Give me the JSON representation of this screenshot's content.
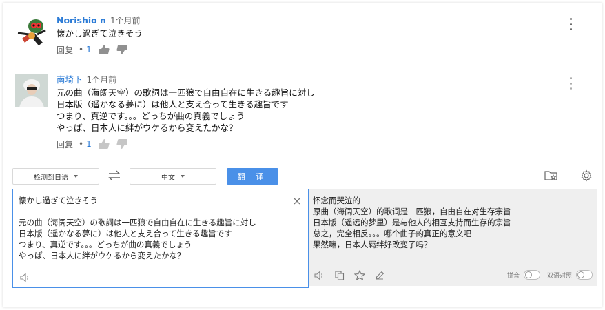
{
  "comments": [
    {
      "author": "Norishio n",
      "time": "1个月前",
      "text": "懐かし過ぎて泣きそう",
      "reply_label": "回复",
      "likes": "1"
    },
    {
      "author": "南埼下",
      "time": "1个月前",
      "text": "元の曲（海阔天空）の歌詞は一匹狼で自由自在に生きる趣旨に対し\n日本版（遥かなる夢に）は他人と支え合って生きる趣旨です\nつまり、真逆です。。。どっちが曲の真義でしょう\nやっぱ、日本人に絆がウケるから変えたかな？",
      "reply_label": "回复",
      "likes": "1"
    }
  ],
  "translator": {
    "source_lang": "检测到日语",
    "target_lang": "中文",
    "translate_button": "翻 译",
    "source_text": "懐かし過ぎて泣きそう\n\n元の曲（海阔天空）の歌詞は一匹狼で自由自在に生きる趣旨に対し\n日本版（遥かなる夢に）は他人と支え合って生きる趣旨です\nつまり、真逆です。。。どっちが曲の真義でしょう\nやっぱ、日本人に絆がウケるから変えたかな？",
    "output_text": "怀念而哭泣的\n原曲（海阔天空）的歌词是一匹狼，自由自在对生存宗旨\n日本版（遥远的梦里）是与他人的相互支持而生存的宗旨\n总之，完全相反。。。哪个曲子的真正的意义吧\n果然嘛，日本人羁绊好改变了吗？",
    "pinyin_label": "拼音",
    "bilingual_label": "双语对照"
  },
  "colors": {
    "accent": "#4a90e8",
    "author": "#2b7bd6"
  }
}
